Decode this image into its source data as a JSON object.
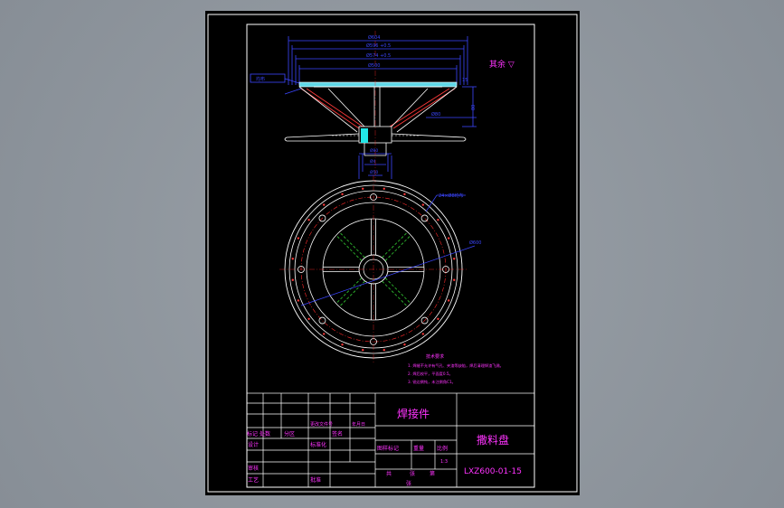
{
  "colors": {
    "background": "#8c939b",
    "sheet": "#000000",
    "frame": "#ffffff",
    "dimension": "#3b46ff",
    "notes": "#ff33ff",
    "part": "#ffffff",
    "cyan": "#22e6e6",
    "centerline": "#ff2a2a",
    "hidden": "#33cc33"
  },
  "top_right_note": "其余 ▽",
  "dims": {
    "d_overall": "Ø604",
    "d_second": "Ø596 +0.5",
    "d_third": "Ø574 +0.5",
    "d_fourth": "Ø500",
    "left_box": "均布",
    "right_small": "15",
    "right_height": "80",
    "inner_label": "Ø80",
    "bottom_a": "Ø4",
    "bottom_b": "Ø50",
    "bottom_c": "Ø80",
    "plan_holes": "24×Ø8均布",
    "plan_dia": "Ø600"
  },
  "notes": {
    "title": "技术要求",
    "lines": [
      "1. 焊缝不允许有气孔、夹渣等缺陷，焊后清理焊渣飞溅。",
      "2. 焊后校平，平面度0.5。",
      "3. 锐边倒钝，未注倒角C1。"
    ]
  },
  "title_block": {
    "weld_label": "焊接件",
    "part_name": "撒料盘",
    "drawing_no": "LXZ600-01-15",
    "row_labels": [
      "标记",
      "处数",
      "分区",
      "更改文件号",
      "签名",
      "年月日"
    ],
    "left_labels": [
      "设计",
      "审核",
      "工艺"
    ],
    "mid_labels": [
      "标准化",
      "批准"
    ],
    "stage_labels": [
      "图样标记",
      "重量",
      "比例"
    ],
    "scale": "1:3",
    "sheet_labels": [
      "共",
      "张",
      "第",
      "张"
    ]
  }
}
